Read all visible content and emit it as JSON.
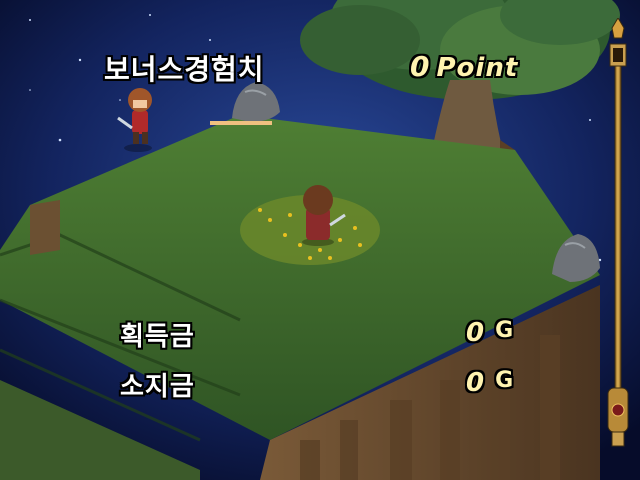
{
  "hud": {
    "bonus_exp": {
      "label": "보너스경험치",
      "value": "0",
      "unit": "Point"
    },
    "gold_earned": {
      "label": "획득금",
      "value": "0",
      "unit": "G"
    },
    "gold_held": {
      "label": "소지금",
      "value": "0",
      "unit": "G"
    }
  },
  "colors": {
    "sky": "#0a1540",
    "grass": "#3f6b2c",
    "cliff": "#6b5032",
    "tree_canopy": "#3c6b3a",
    "text": "#ffffff",
    "number": "#fff3b0",
    "gauge_gold": "#c99a3a"
  }
}
